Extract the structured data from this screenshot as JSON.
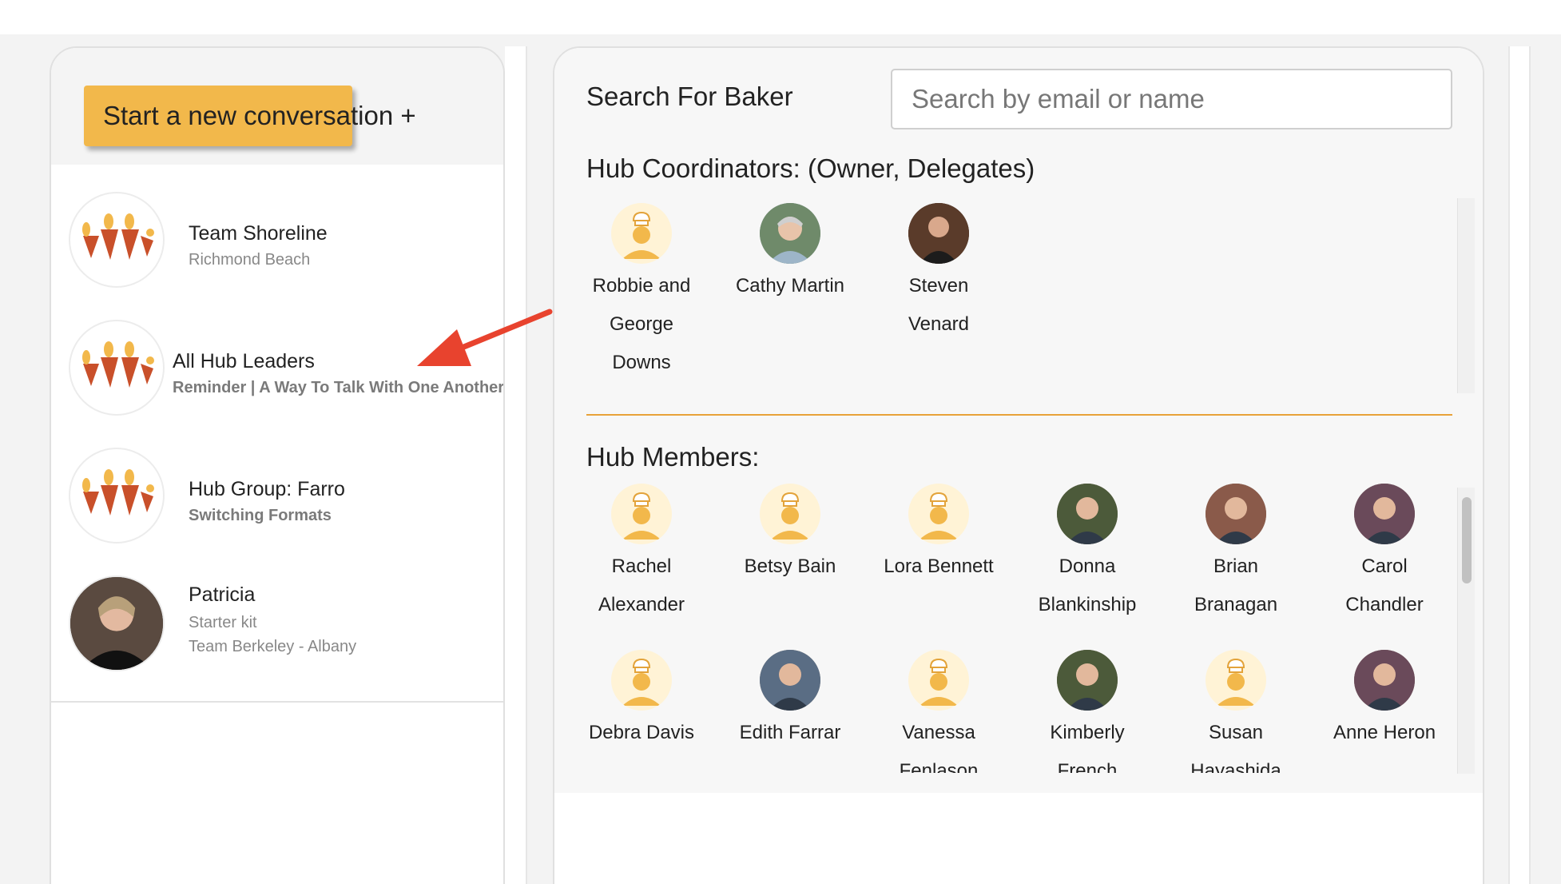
{
  "sidebar": {
    "new_conversation_label": "Start a new conversation +",
    "conversations": [
      {
        "title": "Team Shoreline",
        "subtitle": "Richmond Beach",
        "subtitle2": "",
        "avatar": "hub-logo-icon"
      },
      {
        "title": "All Hub Leaders",
        "subtitle": "Reminder | A Way To Talk With One Another",
        "subtitle2": "",
        "avatar": "hub-logo-icon"
      },
      {
        "title": "Hub Group: Farro",
        "subtitle": "Switching Formats",
        "subtitle2": "",
        "avatar": "hub-logo-icon"
      },
      {
        "title": "Patricia",
        "subtitle": "Starter kit",
        "subtitle2": "Team Berkeley - Albany",
        "avatar": "user-photo"
      }
    ]
  },
  "main": {
    "search_label": "Search For Baker",
    "search_placeholder": "Search by email or name",
    "coordinators_title": "Hub Coordinators: (Owner, Delegates)",
    "members_title": "Hub Members:",
    "coordinators": [
      {
        "name": "Robbie and George Downs",
        "avatar": "default-chef-icon"
      },
      {
        "name": "Cathy Martin",
        "avatar": "photo"
      },
      {
        "name": "Steven Venard",
        "avatar": "photo"
      }
    ],
    "members": [
      {
        "name": "Rachel Alexander",
        "avatar": "default-chef-icon"
      },
      {
        "name": "Betsy Bain",
        "avatar": "default-chef-icon"
      },
      {
        "name": "Lora Bennett",
        "avatar": "default-chef-icon"
      },
      {
        "name": "Donna Blankinship",
        "avatar": "photo"
      },
      {
        "name": "Brian Branagan",
        "avatar": "photo"
      },
      {
        "name": "Carol Chandler",
        "avatar": "photo"
      },
      {
        "name": "Debra Davis",
        "avatar": "default-chef-icon"
      },
      {
        "name": "Edith Farrar",
        "avatar": "photo"
      },
      {
        "name": "Vanessa Fenlason",
        "avatar": "default-chef-icon"
      },
      {
        "name": "Kimberly French",
        "avatar": "photo"
      },
      {
        "name": "Susan Hayashida",
        "avatar": "default-chef-icon"
      },
      {
        "name": "Anne Heron",
        "avatar": "photo"
      }
    ]
  },
  "colors": {
    "accent": "#f2b84b",
    "separator": "#e8a23a",
    "annotation_arrow": "#e8432e",
    "logo": "#c9502a"
  }
}
